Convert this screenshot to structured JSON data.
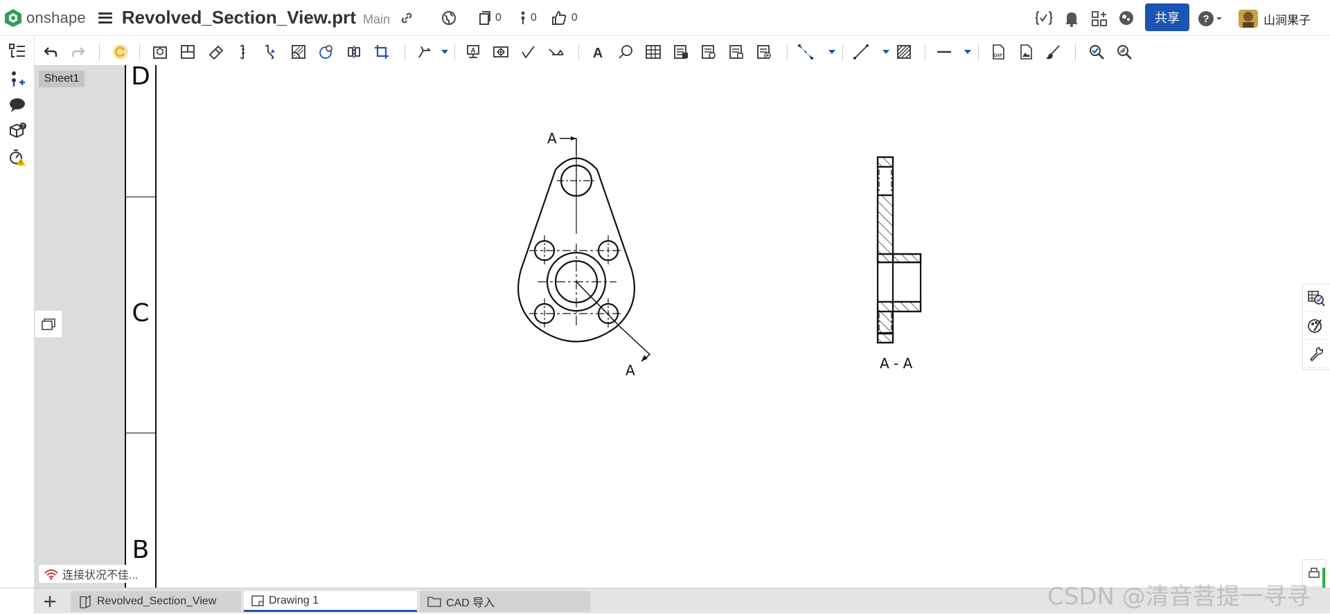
{
  "app": {
    "logo_text": "onshape"
  },
  "document": {
    "title": "Revolved_Section_View.prt",
    "branch": "Main"
  },
  "header": {
    "versions_count": "0",
    "branches_count": "0",
    "likes_count": "0",
    "share_label": "共享",
    "user_name": "山涧果子",
    "icons": [
      "link-icon",
      "globe-icon",
      "versions-icon",
      "branches-icon",
      "like-icon",
      "code-icon",
      "bell-icon",
      "apps-icon",
      "learning-icon",
      "help-icon"
    ]
  },
  "sheets": {
    "active": "Sheet1"
  },
  "drawing": {
    "zones": [
      "D",
      "C",
      "B"
    ],
    "section_label_top": "A",
    "section_label_bottom": "A",
    "section_view_caption": "A - A"
  },
  "status": {
    "connection": "连接状况不佳..."
  },
  "bottom_tabs": [
    {
      "label": "Revolved_Section_View",
      "active": false
    },
    {
      "label": "Drawing 1",
      "active": true
    },
    {
      "label": "CAD 导入",
      "active": false
    }
  ],
  "watermark": "CSDN @清音菩提一寻寻",
  "colors": {
    "accent": "#1b55b3",
    "sheet_panel": "#dcdcdc",
    "bottom_bar": "#e4e4e4"
  }
}
